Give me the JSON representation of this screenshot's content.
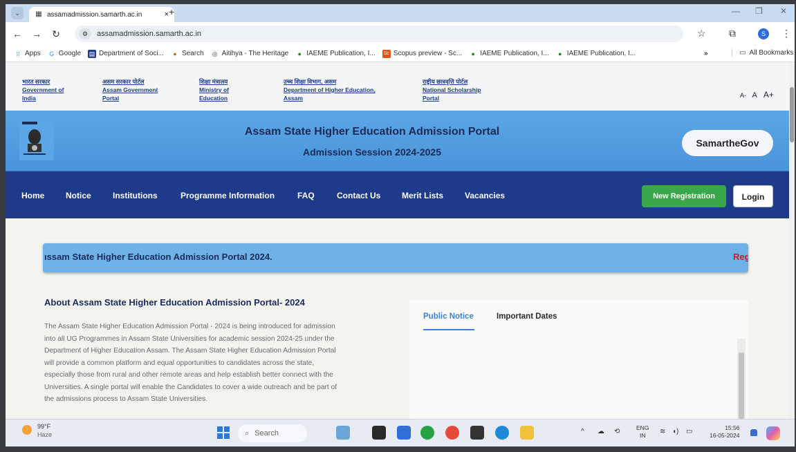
{
  "browser": {
    "tab_title": "assamadmission.samarth.ac.in",
    "tab_close": "×",
    "new_tab": "+",
    "url": "assamadmission.samarth.ac.in",
    "bookmarks": [
      {
        "label": "Apps",
        "icon": "apps-grid-icon",
        "color": "#1a73e8"
      },
      {
        "label": "Google",
        "icon": "google-icon",
        "color": "#4285f4"
      },
      {
        "label": "Department of Soci...",
        "icon": "doc-icon",
        "color": "#1e3a8a"
      },
      {
        "label": "Search",
        "icon": "search-engine-icon",
        "color": "#b07a2a"
      },
      {
        "label": "Aitihya - The Heritage",
        "icon": "heritage-icon",
        "color": "#333333"
      },
      {
        "label": "IAEME Publication, I...",
        "icon": "iaeme-icon",
        "color": "#2e7d32"
      },
      {
        "label": "Scopus preview - Sc...",
        "icon": "scopus-icon",
        "color": "#e0531b"
      },
      {
        "label": "IAEME Publication, I...",
        "icon": "iaeme-icon",
        "color": "#2e7d32"
      },
      {
        "label": "IAEME Publication, I...",
        "icon": "iaeme-icon",
        "color": "#2e7d32"
      }
    ],
    "bookmarks_more": "»",
    "all_bookmarks": "All Bookmarks",
    "profile_initial": "S"
  },
  "govbar": {
    "links": [
      {
        "hi": "भारत सरकार",
        "en1": "Government of",
        "en2": "India"
      },
      {
        "hi": "असम सरकार पोर्टल",
        "en1": "Assam Government",
        "en2": "Portal"
      },
      {
        "hi": "शिक्षा मंत्रालय",
        "en1": "Ministry of",
        "en2": "Education"
      },
      {
        "hi": "उच्च शिक्षा विभाग, असम",
        "en1": "Department of Higher Education,",
        "en2": "Assam"
      },
      {
        "hi": "राष्ट्रीय छात्रवृत्ति पोर्टल",
        "en1": "National Scholarship",
        "en2": "Portal"
      }
    ],
    "font_small": "A-",
    "font_normal": "A",
    "font_large": "A+"
  },
  "header": {
    "title": "Assam State Higher Education Admission Portal",
    "session": "Admission Session 2024-2025",
    "brand": "SamartheGov"
  },
  "menu": {
    "items": [
      "Home",
      "Notice",
      "Institutions",
      "Programme Information",
      "FAQ",
      "Contact Us",
      "Merit Lists",
      "Vacancies"
    ],
    "register": "New Registration",
    "login": "Login"
  },
  "main": {
    "marquee": "ıssam State Higher Education Admission Portal 2024.",
    "marquee_tail": "Reg",
    "about_title": "About Assam State Higher Education Admission Portal- 2024",
    "about_lines": [
      "The Assam State Higher Education Admission Portal - 2024 is being introduced for admission",
      "into all UG Programmes in Assam State Universities for academic session 2024-25 under the",
      "Department of Higher Education Assam. The Assam State Higher Education Admission Portal",
      "will provide a common platform and equal opportunities to candidates across the state,",
      "especially those from rural and other remote areas and help establish better connect with the",
      "Universities. A single portal will enable the Candidates to cover a wide outreach and be part of",
      "the admissions process to Assam State Universities."
    ],
    "notice_tabs": [
      "Public Notice",
      "Important Dates"
    ]
  },
  "taskbar": {
    "temp": "99°F",
    "weather": "Haze",
    "search": "Search",
    "lang1": "ENG",
    "lang2": "IN",
    "time": "15:56",
    "date": "16-05-2024"
  }
}
